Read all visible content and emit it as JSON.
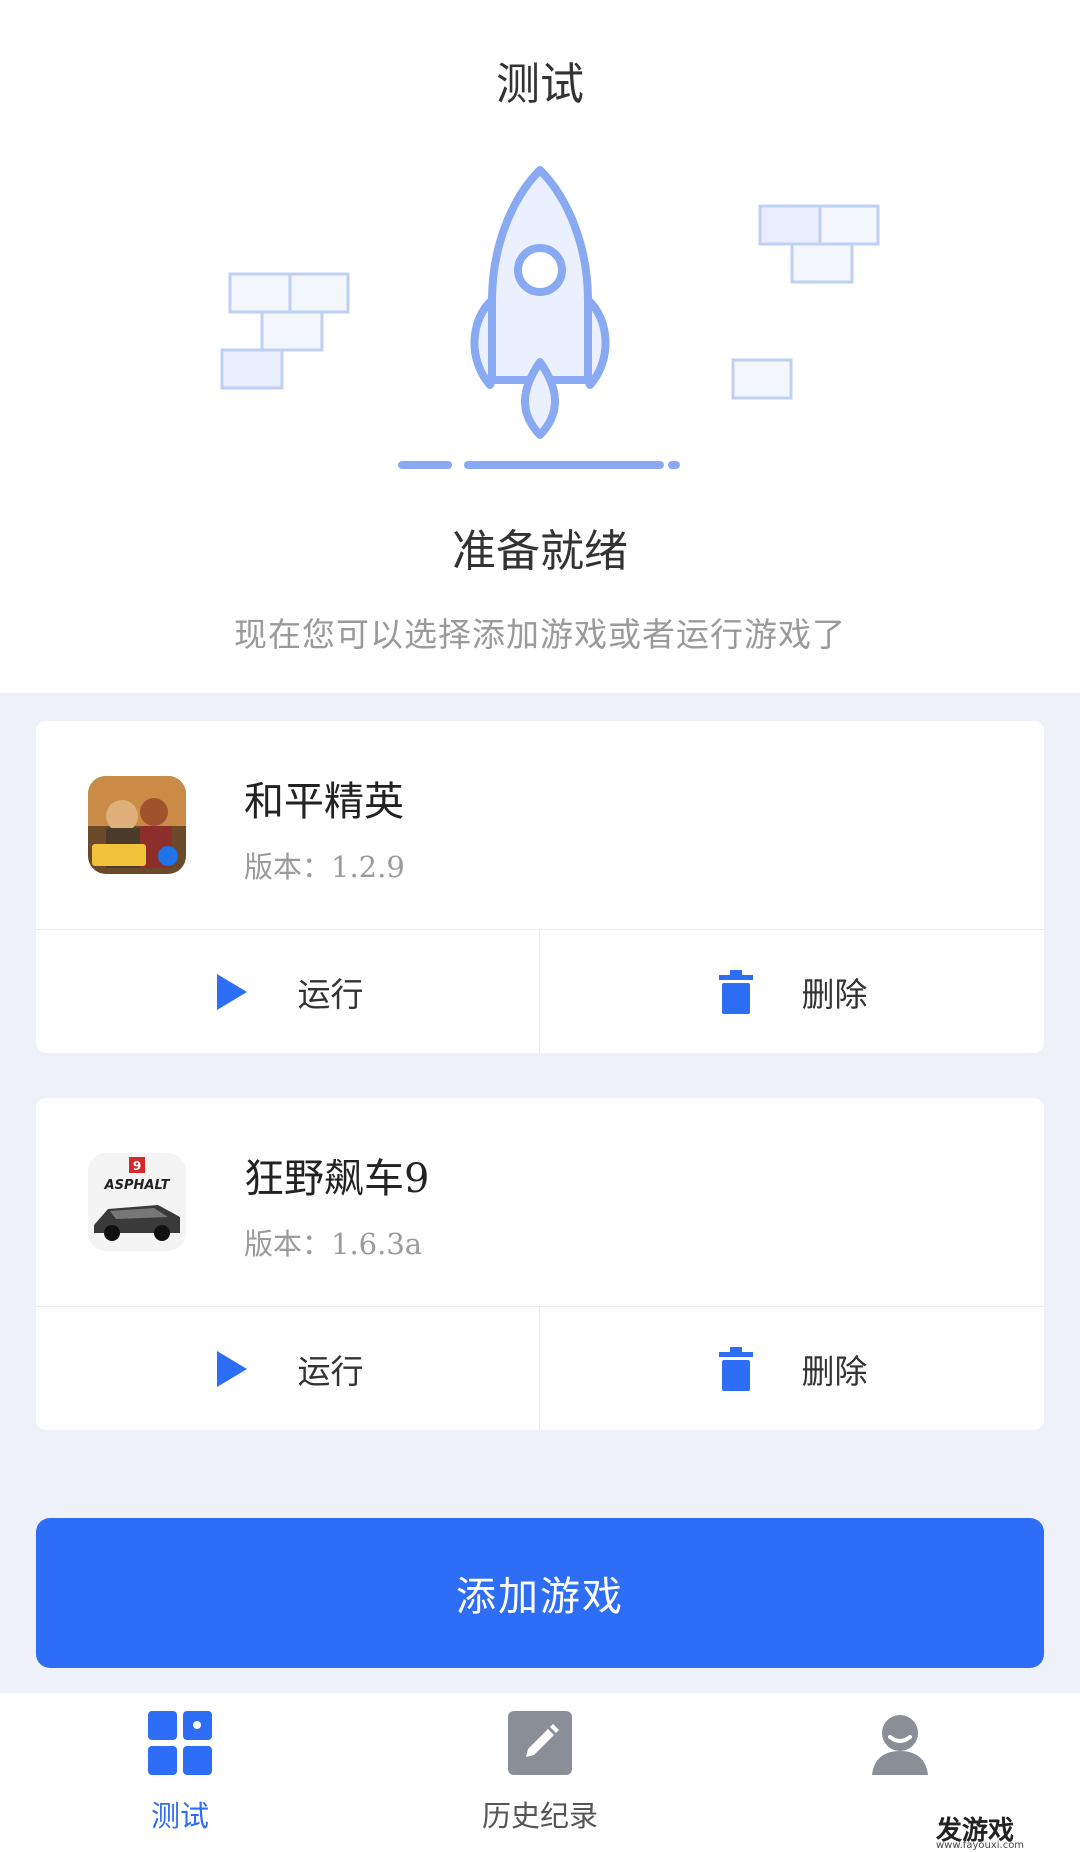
{
  "header": {
    "title": "测试"
  },
  "hero": {
    "status": "准备就绪",
    "subtitle": "现在您可以选择添加游戏或者运行游戏了"
  },
  "games": [
    {
      "name": "和平精英",
      "version": "版本：1.2.9",
      "run_label": "运行",
      "delete_label": "删除",
      "icon": "peace-elite-game-icon"
    },
    {
      "name": "狂野飙车9",
      "version": "版本：1.6.3a",
      "run_label": "运行",
      "delete_label": "删除",
      "icon": "asphalt9-game-icon"
    }
  ],
  "add_button": {
    "label": "添加游戏"
  },
  "tabbar": {
    "items": [
      {
        "label": "测试",
        "icon": "grid-icon",
        "active": true
      },
      {
        "label": "历史纪录",
        "icon": "pencil-icon",
        "active": false
      },
      {
        "label": "",
        "icon": "user-icon",
        "active": false
      }
    ]
  },
  "watermark": {
    "text": "发游戏",
    "url": "www.fayouxi.com"
  },
  "colors": {
    "accent": "#2e6df5",
    "background": "#eef1f7",
    "icon_light": "#89aaf2"
  }
}
